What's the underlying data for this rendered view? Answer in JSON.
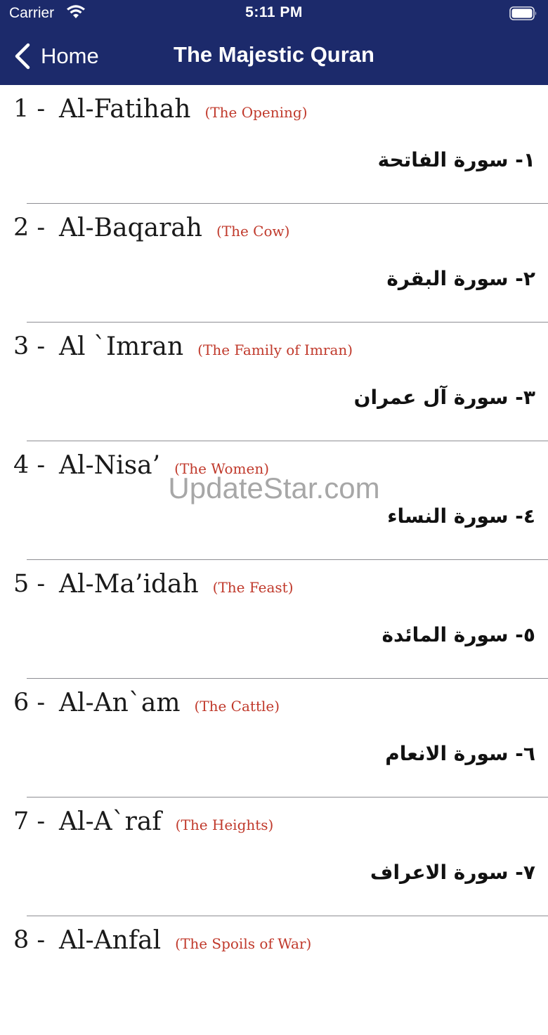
{
  "status_bar": {
    "carrier": "Carrier",
    "time": "5:11 PM",
    "wifi_icon": "wifi-icon",
    "battery_icon": "battery-icon"
  },
  "nav_bar": {
    "back_label": "Home",
    "back_icon": "chevron-left-icon",
    "title": "The Majestic Quran",
    "background": "#1c2a6b"
  },
  "surahs": [
    {
      "number": "1 -",
      "name": "Al-Fatihah",
      "english": "(The Opening)",
      "arabic": "١- سورة الفاتحة"
    },
    {
      "number": "2 -",
      "name": "Al-Baqarah",
      "english": "(The Cow)",
      "arabic": "٢- سورة البقرة"
    },
    {
      "number": "3 -",
      "name": "Al `Imran",
      "english": "(The Family of Imran)",
      "arabic": "٣- سورة آل عمران"
    },
    {
      "number": "4 -",
      "name": "Al-Nisa’",
      "english": "(The Women)",
      "arabic": "٤- سورة النساء"
    },
    {
      "number": "5 -",
      "name": "Al-Ma’idah",
      "english": "(The Feast)",
      "arabic": "٥- سورة المائدة"
    },
    {
      "number": "6 -",
      "name": "Al-An`am",
      "english": "(The Cattle)",
      "arabic": "٦- سورة الانعام"
    },
    {
      "number": "7 -",
      "name": "Al-A`raf",
      "english": "(The Heights)",
      "arabic": "٧- سورة الاعراف"
    },
    {
      "number": "8 -",
      "name": "Al-Anfal",
      "english": "(The Spoils of War)",
      "arabic": ""
    }
  ],
  "watermark": "UpdateStar.com",
  "colors": {
    "header": "#1c2a6b",
    "english_meaning": "#c0392b",
    "separator": "#8e8e93"
  }
}
